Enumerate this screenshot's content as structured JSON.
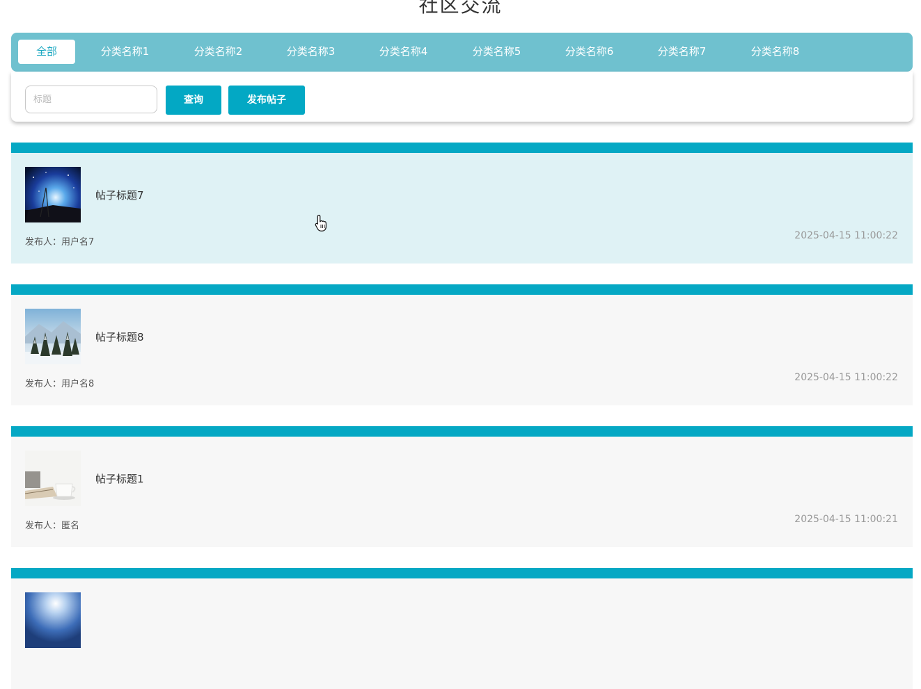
{
  "page": {
    "title": "社区交流"
  },
  "categories": {
    "tabs": [
      {
        "label": "全部",
        "active": true
      },
      {
        "label": "分类名称1",
        "active": false
      },
      {
        "label": "分类名称2",
        "active": false
      },
      {
        "label": "分类名称3",
        "active": false
      },
      {
        "label": "分类名称4",
        "active": false
      },
      {
        "label": "分类名称5",
        "active": false
      },
      {
        "label": "分类名称6",
        "active": false
      },
      {
        "label": "分类名称7",
        "active": false
      },
      {
        "label": "分类名称8",
        "active": false
      }
    ]
  },
  "search": {
    "placeholder": "标题",
    "value": "",
    "query_label": "查询",
    "publish_label": "发布帖子"
  },
  "posts": [
    {
      "title": "帖子标题7",
      "author_label": "发布人：",
      "author": "用户名7",
      "time": "2025-04-15 11:00:22",
      "thumb": "starry-night-icon"
    },
    {
      "title": "帖子标题8",
      "author_label": "发布人：",
      "author": "用户名8",
      "time": "2025-04-15 11:00:22",
      "thumb": "snowy-forest-icon"
    },
    {
      "title": "帖子标题1",
      "author_label": "发布人：",
      "author": "匿名",
      "time": "2025-04-15 11:00:21",
      "thumb": "coffee-cup-icon"
    },
    {
      "title": "",
      "author_label": "",
      "author": "",
      "time": "",
      "thumb": "sky-icon"
    }
  ],
  "colors": {
    "accent": "#05a8c4",
    "category_bar": "#6fc1cf",
    "hover_row": "#dff2f5",
    "row": "#f7f7f7"
  }
}
